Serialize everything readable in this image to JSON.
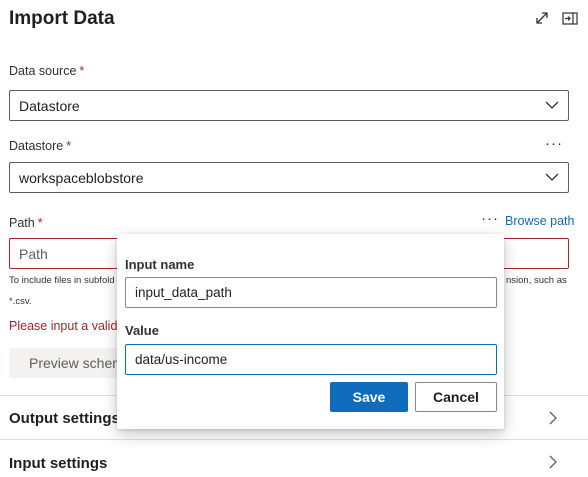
{
  "panel": {
    "title": "Import Data"
  },
  "icons": {
    "expand": "expand-icon",
    "pin": "dock-panel-icon",
    "chevron": "chevron-down-icon",
    "more": "more-icon"
  },
  "data_source": {
    "label": "Data source",
    "required_mark": "*",
    "value": "Datastore"
  },
  "datastore": {
    "label": "Datastore",
    "required_mark": "*",
    "value": "workspaceblobstore",
    "more": "···"
  },
  "path": {
    "label": "Path",
    "required_mark": "*",
    "more": "···",
    "browse_label": "Browse path",
    "placeholder": "Path",
    "hint_left": "To include files in subfold",
    "hint_right": "nsion, such as",
    "hint_line2": "*.csv.",
    "error": "Please input a valid p"
  },
  "preview_button": {
    "label": "Preview schem"
  },
  "sections": [
    {
      "title": "Output settings"
    },
    {
      "title": "Input settings"
    }
  ],
  "popup": {
    "input_name_label": "Input name",
    "input_name_value": "input_data_path",
    "value_label": "Value",
    "value_value": "data/us-income",
    "save_label": "Save",
    "cancel_label": "Cancel"
  },
  "colors": {
    "accent": "#0f6cbd",
    "error": "#a4262c",
    "border": "#605e5c"
  }
}
